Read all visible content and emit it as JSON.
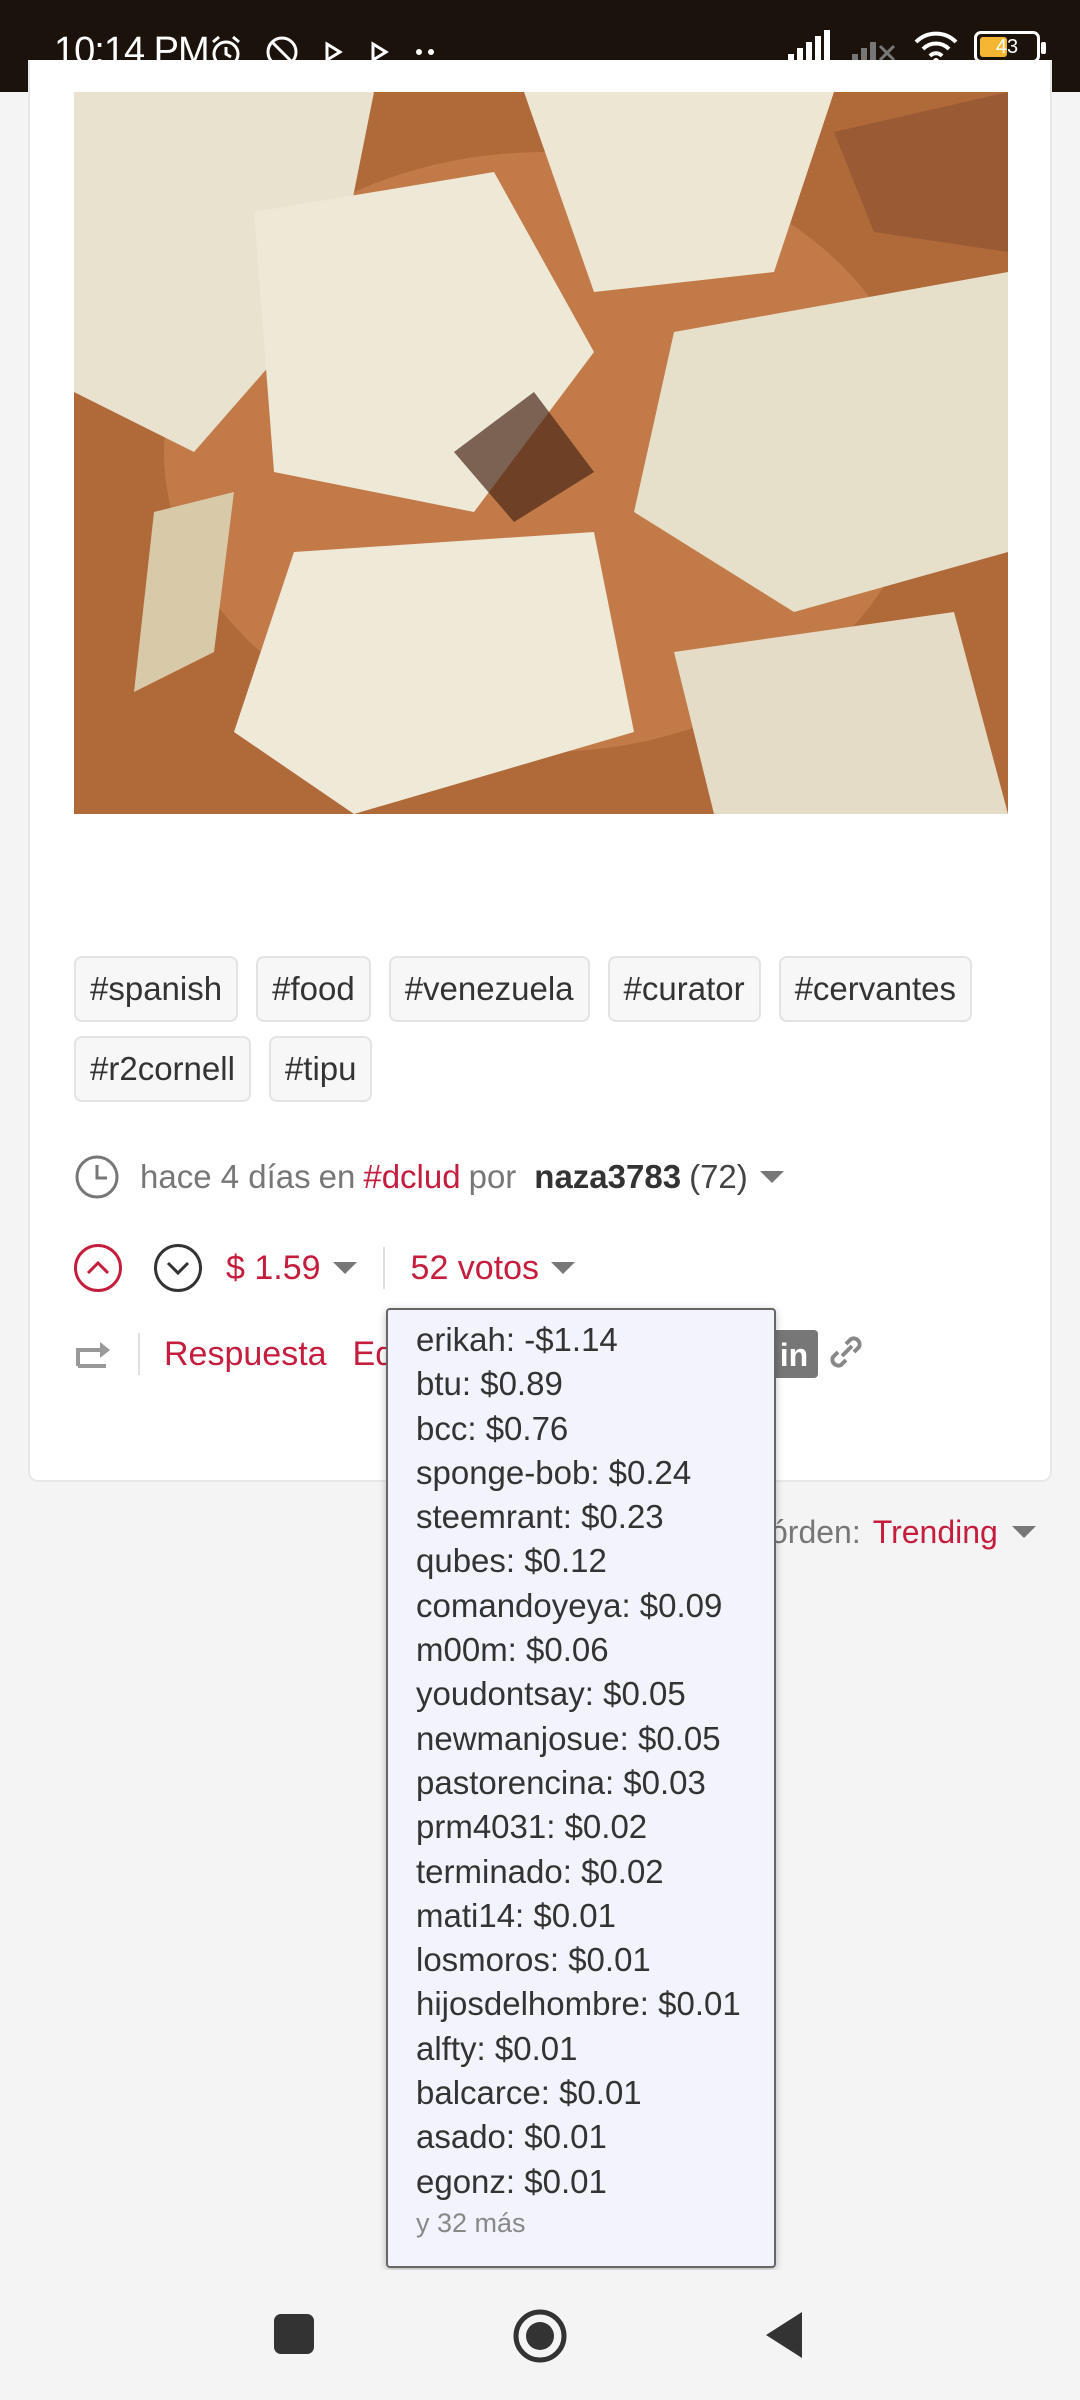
{
  "status_bar": {
    "time": "10:14 PM",
    "battery": "43"
  },
  "post": {
    "tags": [
      "#spanish",
      "#food",
      "#venezuela",
      "#curator",
      "#cervantes",
      "#r2cornell",
      "#tipu"
    ],
    "meta": {
      "age": "hace 4 días",
      "in_word": "en",
      "category": "#dclud",
      "by_word": "por",
      "author": "naza3783",
      "reputation": "(72)"
    },
    "payout": "$ 1.59",
    "votes_label": "52 votos",
    "reply_label": "Respuesta",
    "edit_label": "Edi"
  },
  "sort": {
    "label": "órden:",
    "value": "Trending"
  },
  "voters_dropdown": {
    "voters": [
      "erikah: -$1.14",
      "btu: $0.89",
      "bcc: $0.76",
      "sponge-bob: $0.24",
      "steemrant: $0.23",
      "qubes: $0.12",
      "comandoyeya: $0.09",
      "m00m: $0.06",
      "youdontsay: $0.05",
      "newmanjosue: $0.05",
      "pastorencina: $0.03",
      "prm4031: $0.02",
      "terminado: $0.02",
      "mati14: $0.01",
      "losmoros: $0.01",
      "hijosdelhombre: $0.01",
      "alfty: $0.01",
      "balcarce: $0.01",
      "asado: $0.01",
      "egonz: $0.01"
    ],
    "more": "y 32 más"
  },
  "colors": {
    "accent": "#c51d3d",
    "status_bar_bg": "#1a120b",
    "dropdown_bg": "#f2f3fc"
  }
}
